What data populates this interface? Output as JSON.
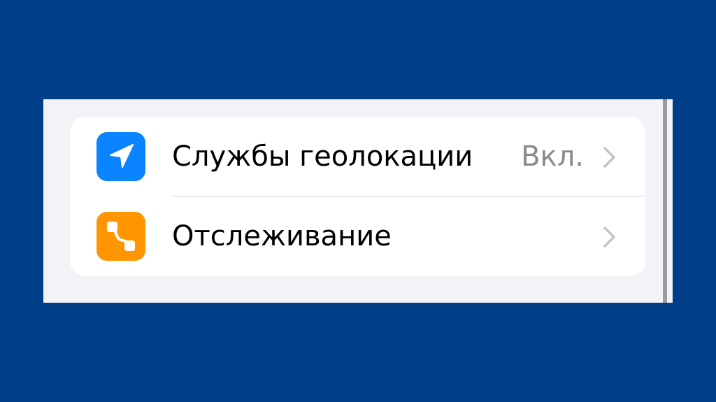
{
  "settings_group": {
    "items": [
      {
        "label": "Службы геолокации",
        "value": "Вкл.",
        "icon": "location-arrow-icon",
        "icon_color": "#0a84ff"
      },
      {
        "label": "Отслеживание",
        "value": "",
        "icon": "tracking-icon",
        "icon_color": "#ff9500"
      }
    ]
  },
  "colors": {
    "background": "#003f87",
    "screen_background": "#f2f2f7",
    "cell_background": "#ffffff",
    "secondary_text": "#8a8a8e",
    "chevron": "#c4c4c7"
  }
}
